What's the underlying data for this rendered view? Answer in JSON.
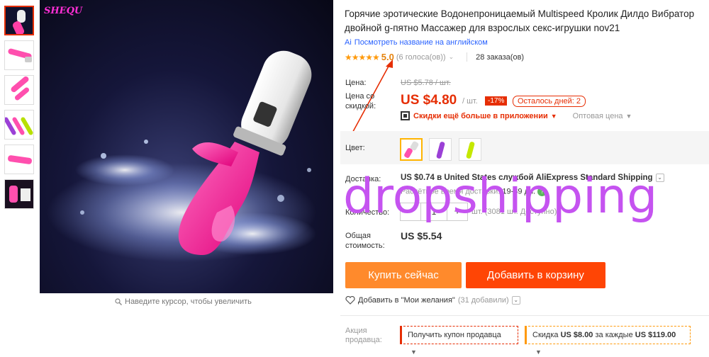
{
  "gallery": {
    "brand": "SHEQU",
    "zoom_hint": "Наведите курсор, чтобы увеличить"
  },
  "product": {
    "title": "Горячие эротические Водонепроницаемый Multispeed Кролик Дилдо Вибратор двойной g-пятно Массажер для взрослых секс-игрушки nov21",
    "translate_link": "Посмотреть название на английском",
    "rating": "5.0",
    "votes": "(6 голоса(ов))",
    "orders": "28 заказа(ов)"
  },
  "pricing": {
    "price_label": "Цена:",
    "old_price": "US $5.78 / шт.",
    "discount_price_label": "Цена со скидкой:",
    "price": "US $4.80",
    "per_unit": "/ шт.",
    "discount": "-17%",
    "days_left": "Осталось дней: 2",
    "app_promo": "Скидки ещё больше в приложении",
    "wholesale": "Оптовая цена"
  },
  "options": {
    "color_label": "Цвет:"
  },
  "shipping": {
    "label": "Доставка:",
    "main": "US $0.74 в United States службой AliExpress Standard Shipping",
    "time_label": "Расчётное время доставки:",
    "time_value": "19-39 дн."
  },
  "quantity": {
    "label": "Количество:",
    "value": "1",
    "minus": "−",
    "plus": "+",
    "available": "шт. (3081 шт. Доступно)"
  },
  "total": {
    "label": "Общая стоимость:",
    "value": "US $5.54"
  },
  "actions": {
    "buy_now": "Купить сейчас",
    "add_to_cart": "Добавить в корзину",
    "wishlist": "Добавить в \"Мои желания\"",
    "wishlist_count": "(31 добавили)"
  },
  "promo": {
    "label": "Акция продавца:",
    "coupon": "Получить купон продавца",
    "discount_text_1": "Скидка",
    "discount_amount": "US $8.00",
    "discount_text_2": "за каждые",
    "discount_threshold": "US $119.00"
  },
  "overlay_text": "dropshipping",
  "colors": {
    "accent": "#e62e04",
    "buy": "#ff8a2c",
    "cart": "#ff4505",
    "star": "#ff9a0c",
    "link": "#2962ff",
    "overlay": "#c553f0"
  }
}
